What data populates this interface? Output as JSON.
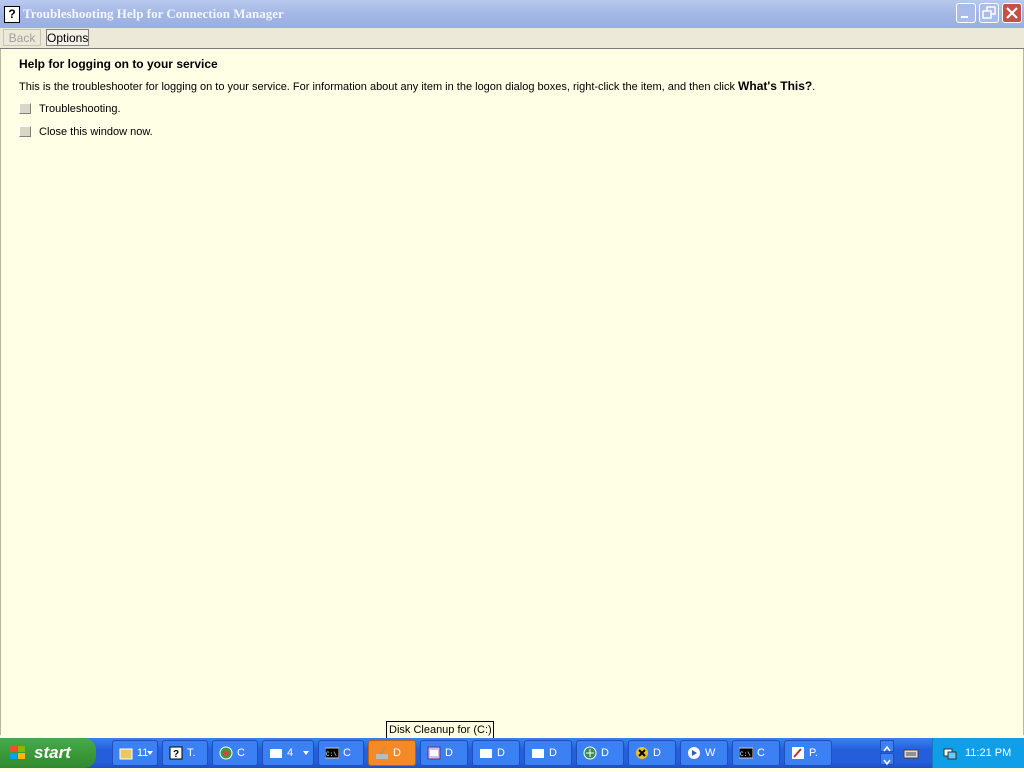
{
  "window": {
    "title": "Troubleshooting Help for Connection Manager",
    "app_icon": "?"
  },
  "toolbar": {
    "back_label": "Back",
    "options_label": "Options"
  },
  "content": {
    "heading": "Help for logging on to your service",
    "intro_text": "This is the troubleshooter for logging on to your service. For information about any item in the logon dialog boxes, right-click the item, and then click ",
    "intro_bold": "What's This?",
    "intro_end": ".",
    "options": [
      {
        "label": "Troubleshooting."
      },
      {
        "label": "Close this window now."
      }
    ]
  },
  "tooltip": {
    "text": "Disk Cleanup for  (C:)"
  },
  "taskbar": {
    "start_label": "start",
    "buttons": [
      {
        "label": "11",
        "icon": "folder-group-icon",
        "active": false
      },
      {
        "label": "T.",
        "icon": "help-icon",
        "active": false
      },
      {
        "label": "C",
        "icon": "connection-manager-icon",
        "active": false
      },
      {
        "label": "4",
        "icon": "window-group-icon",
        "active": false
      },
      {
        "label": "C",
        "icon": "command-prompt-icon",
        "active": false
      },
      {
        "label": "D",
        "icon": "disk-cleanup-icon",
        "active": true
      },
      {
        "label": "D",
        "icon": "dialog-icon",
        "active": false
      },
      {
        "label": "D",
        "icon": "window-icon",
        "active": false
      },
      {
        "label": "D",
        "icon": "window-icon",
        "active": false
      },
      {
        "label": "D",
        "icon": "network-icon",
        "active": false
      },
      {
        "label": "D",
        "icon": "x-icon",
        "active": false
      },
      {
        "label": "W",
        "icon": "media-icon",
        "active": false
      },
      {
        "label": "C",
        "icon": "command-prompt-icon",
        "active": false
      },
      {
        "label": "P.",
        "icon": "paint-icon",
        "active": false
      }
    ],
    "clock": "11:21 PM"
  },
  "colors": {
    "title_bar": "#a3b7e6",
    "content_bg": "#ffffe6",
    "taskbar": "#245edb",
    "active_task": "#f48a25",
    "start_button": "#3c9a3a",
    "tray": "#0f9ee8"
  }
}
